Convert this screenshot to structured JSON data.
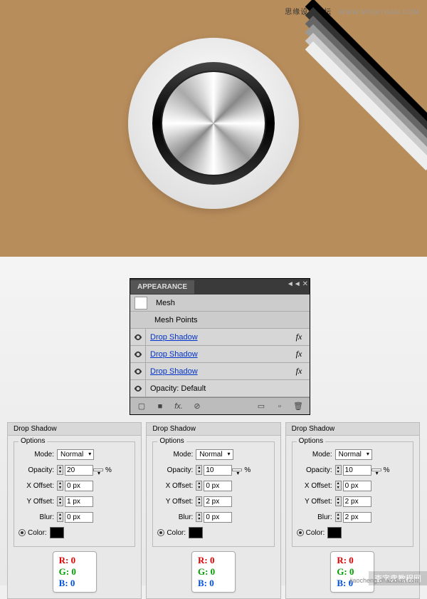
{
  "watermark": {
    "cn": "思缘设计论坛",
    "en": "WWW.MISSYUAN.COM"
  },
  "bottom_watermark": {
    "cn": "查字典教程网",
    "en": "jiaocheng.chazidian.com"
  },
  "appearance": {
    "title": "APPEARANCE",
    "mesh": "Mesh",
    "mesh_points": "Mesh Points",
    "drop_shadow": "Drop Shadow",
    "fx": "fx",
    "opacity_label": "Opacity:",
    "opacity_value": "Default",
    "footer": {
      "fx": "fx."
    }
  },
  "ds": {
    "title": "Drop Shadow",
    "options": "Options",
    "mode_label": "Mode:",
    "mode_value": "Normal",
    "opacity_label": "Opacity:",
    "xoffset_label": "X Offset:",
    "yoffset_label": "Y Offset:",
    "blur_label": "Blur:",
    "color_label": "Color:",
    "percent": "%",
    "panels": [
      {
        "opacity": "20",
        "xoffset": "0 px",
        "yoffset": "1 px",
        "blur": "0 px"
      },
      {
        "opacity": "10",
        "xoffset": "0 px",
        "yoffset": "2 px",
        "blur": "0 px"
      },
      {
        "opacity": "10",
        "xoffset": "0 px",
        "yoffset": "2 px",
        "blur": "2 px"
      }
    ]
  },
  "rgb": {
    "r": "R: 0",
    "g": "G: 0",
    "b": "B: 0"
  }
}
